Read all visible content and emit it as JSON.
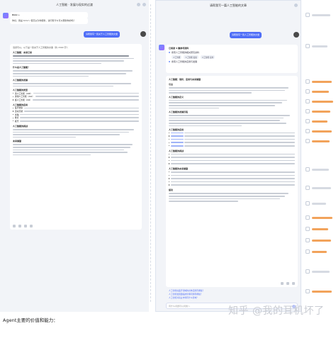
{
  "left_pane": {
    "title": "人工智能 · 发展与现实的过渡",
    "greeting_user": "Kimi +",
    "bot_intro": "你好，我是 Kimi～ 很高兴为你服务，请问有什么可以帮助你的吗？",
    "user_prompt": "请帮我写一篇关于人工智能的文章",
    "reply_intro": "当然可以，以下是一篇关于人工智能的文章（约 1500 字）：",
    "article_title": "人工智能：未来已来",
    "sections": [
      "什么是人工智能？",
      "人工智能的发展",
      "人工智能的类型",
      "人工智能的应用",
      "人工智能的挑战",
      "未来展望"
    ],
    "types": [
      "弱人工智能（ANI）",
      "通用人工智能（AGI）",
      "超人工智能（ASI）"
    ],
    "apps": [
      "医疗健康",
      "自动驾驶",
      "金融",
      "教育",
      "娱乐"
    ]
  },
  "right_pane": {
    "title": "请帮我写一篇人工智能的文章",
    "user_prompt": "请帮我写一篇人工智能的文章",
    "search_header": "已阅读 4 篇参考资料",
    "search_items": [
      "搜索人工智能的相关研究资料",
      "搜索人工智能的应用与发展"
    ],
    "search_tags": [
      "人工智能",
      "人工智能 发展",
      "人工智能 应用"
    ],
    "article_title": "人工智能：现状、应用与未来展望",
    "sections": [
      "引言",
      "人工智能的定义",
      "人工智能的发展历程",
      "人工智能的应用",
      "人工智能的挑战",
      "人工智能的未来展望",
      "结论"
    ],
    "composer_placeholder": "有什么问题可以问我～",
    "followups": [
      "人工智能在医疗领域的具体应用有哪些？",
      "人工智能发展面临的伦理问题有哪些？",
      "人工智能对就业市场有什么影响？"
    ]
  },
  "caption": "Agent主要的价值和能力：",
  "watermark": "知乎 @我的耳机坏了"
}
